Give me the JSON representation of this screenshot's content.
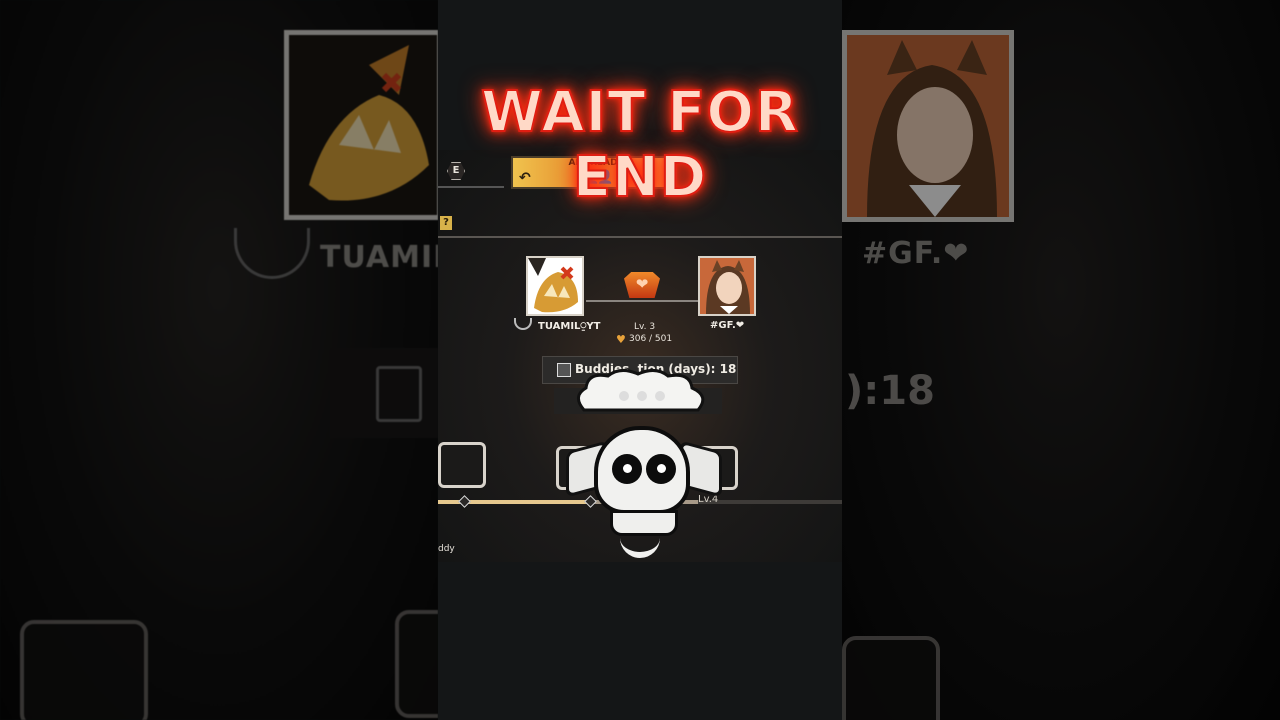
{
  "title": "WAIT FOR END",
  "ready_button": {
    "label": "ALL READY"
  },
  "badge_letter": "E",
  "help_label": "?",
  "player_left": {
    "name": "TUAMIL⍜YT"
  },
  "player_right": {
    "name": "#GF.❤"
  },
  "bond": {
    "level": "Lv. 3",
    "progress": "306 / 501"
  },
  "buddies": {
    "days_text": "Buddies⁠ ⁠ ⁠tion (days): 18"
  },
  "track": {
    "next_level": "Lv.4",
    "label": "ddy"
  },
  "background": {
    "left_name": "TUAMIL",
    "right_name": "#GF.❤",
    "right_days": "):18"
  },
  "colors": {
    "title_glow": "#ff2a10",
    "ready_gold": "#f0c34e",
    "heart_badge": "#e8621e"
  },
  "icons": [
    "e-badge-icon",
    "return-arrow-icon",
    "people-icon",
    "help-icon",
    "heart-wing-icon",
    "calendar-icon",
    "skull-icon",
    "chest-icon"
  ]
}
